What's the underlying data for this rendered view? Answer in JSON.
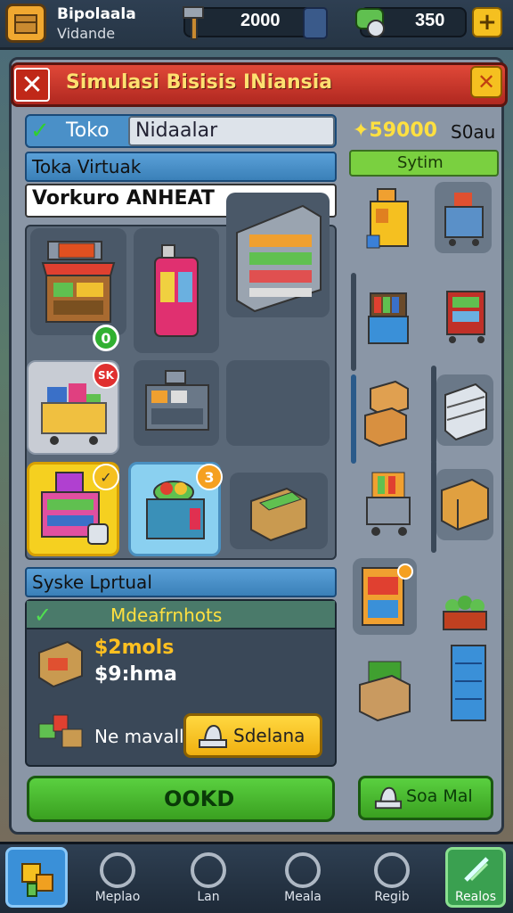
{
  "player": {
    "name": "Bipolaala",
    "subtitle": "Vidande"
  },
  "resources": {
    "coins": "2000",
    "gems": "350",
    "plus_label": "+"
  },
  "dialog": {
    "title": "Simulasi Bisisis INiansia",
    "close_label": "✕"
  },
  "tab": {
    "label": "Toko",
    "field_value": "Nidaalar"
  },
  "store": {
    "header": "Toka Virtuak",
    "search_value": "Vorkuro ANHEAT"
  },
  "store_items": [
    {
      "icon": "market-stall-icon",
      "badge": "0"
    },
    {
      "icon": "vending-machine-icon",
      "badge": ""
    },
    {
      "icon": "shelf-icon",
      "badge": ""
    },
    {
      "icon": "shopping-cart-icon",
      "badge": "SK"
    },
    {
      "icon": "register-counter-icon",
      "badge": ""
    },
    {
      "icon": "empty-icon",
      "badge": ""
    },
    {
      "icon": "purple-shelf-icon",
      "badge": "✓"
    },
    {
      "icon": "bin-display-icon",
      "badge": "3"
    },
    {
      "icon": "cash-box-icon",
      "badge": ""
    }
  ],
  "system": {
    "header": "Syske Lprtual",
    "panel_title": "Mdeafrnhots",
    "price_primary": "$2mols",
    "price_secondary": "$9:hma",
    "manual_label": "Ne mavall",
    "manual_button": "Sdelana"
  },
  "ok_button": "OOKD",
  "right": {
    "coins": "✦59000",
    "coins_label": "S0au",
    "header": "Sytim",
    "side_button": "Soa Mal"
  },
  "nav": {
    "items": [
      {
        "label": "",
        "icon": "home-blocks-icon"
      },
      {
        "label": "Meplao",
        "icon": "search-icon"
      },
      {
        "label": "Lan",
        "icon": "search-icon"
      },
      {
        "label": "Meala",
        "icon": "circle-icon"
      },
      {
        "label": "Regib",
        "icon": "circle-slash-icon"
      },
      {
        "label": "Realos",
        "icon": "paint-icon"
      }
    ]
  },
  "colors": {
    "title_bar": "#e04838",
    "accent_green": "#5ad040",
    "accent_yellow": "#f5c020",
    "tab_blue": "#4a90c8"
  }
}
